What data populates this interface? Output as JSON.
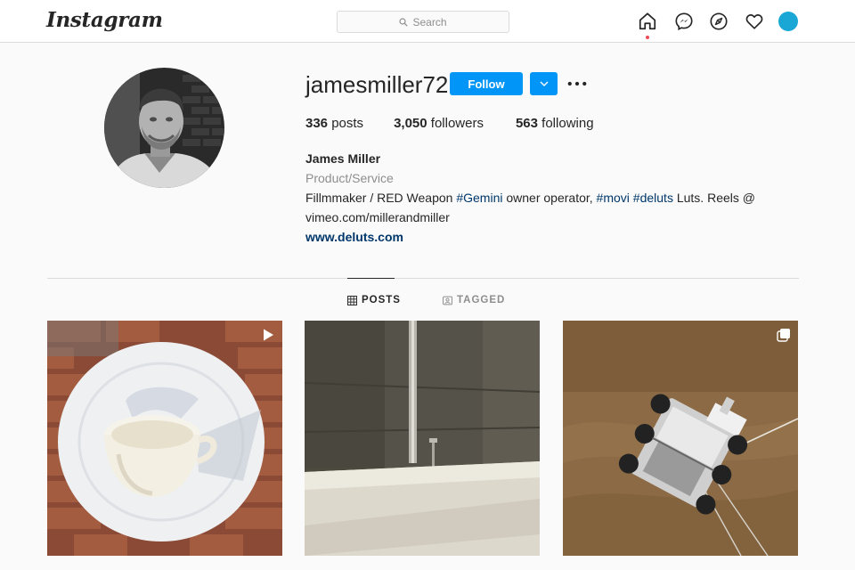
{
  "nav": {
    "logo": "Instagram",
    "search_placeholder": "Search",
    "icons": [
      "home-icon",
      "messenger-icon",
      "explore-icon",
      "activity-heart-icon",
      "profile-avatar"
    ]
  },
  "profile": {
    "username": "jamesmiller72",
    "follow_label": "Follow",
    "stats": {
      "posts_count": "336",
      "posts_label": "posts",
      "followers_count": "3,050",
      "followers_label": "followers",
      "following_count": "563",
      "following_label": "following"
    },
    "bio": {
      "name": "James Miller",
      "category": "Product/Service",
      "line1_text1": "Fillmmaker / RED Weapon ",
      "tag_gemini": "#Gemini",
      "line1_text2": " owner operator, ",
      "tag_movi": "#movi",
      "line1_space": " ",
      "tag_deluts": "#deluts",
      "line1_text3": " Luts. Reels @",
      "line2": "vimeo.com/millerandmiller",
      "website": "www.deluts.com"
    }
  },
  "tabs": [
    {
      "label": "POSTS",
      "active": true
    },
    {
      "label": "TAGGED",
      "active": false
    }
  ],
  "posts": [
    {
      "subject": "teacup on white plate on brick",
      "badge": "video-play-icon"
    },
    {
      "subject": "concrete wall with metal pipe",
      "badge": ""
    },
    {
      "subject": "mars rover on sandy surface",
      "badge": "carousel-icon"
    }
  ],
  "colors": {
    "brand_blue": "#0095f6",
    "link_blue": "#00376b",
    "notification_red": "#ed4956",
    "avatar_cyan": "#1aa7d6",
    "border": "#dbdbdb",
    "muted": "#8e8e8e"
  }
}
